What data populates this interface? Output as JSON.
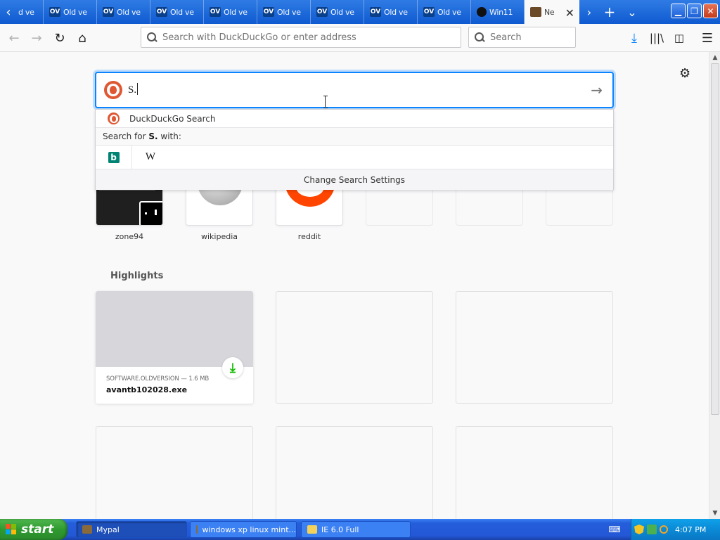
{
  "tabstrip": {
    "tabs": [
      {
        "icon": "OV",
        "title": "d ve",
        "state": "partial"
      },
      {
        "icon": "OV",
        "title": "Old ve"
      },
      {
        "icon": "OV",
        "title": "Old ve"
      },
      {
        "icon": "OV",
        "title": "Old ve"
      },
      {
        "icon": "OV",
        "title": "Old ve"
      },
      {
        "icon": "OV",
        "title": "Old ve"
      },
      {
        "icon": "OV",
        "title": "Old ve"
      },
      {
        "icon": "OV",
        "title": "Old ve"
      },
      {
        "icon": "OV",
        "title": "Old ve"
      },
      {
        "icon": "",
        "title": "Win11"
      },
      {
        "icon": "",
        "title": "Ne",
        "active": true
      }
    ],
    "new_tab_glyph": "+",
    "list_tabs_glyph": "⌄"
  },
  "navbar": {
    "address_placeholder": "Search with DuckDuckGo or enter address",
    "search_placeholder": "Search"
  },
  "search": {
    "query": "S.",
    "go_glyph": "→"
  },
  "dropdown": {
    "engine_name": "DuckDuckGo Search",
    "search_for_prefix": "Search for ",
    "search_for_term": "S.",
    "search_for_suffix": " with:",
    "engines": [
      {
        "name": "bing",
        "glyph": "b"
      },
      {
        "name": "wikipedia",
        "glyph": "W"
      }
    ],
    "settings_label": "Change Search Settings"
  },
  "top_sites": [
    {
      "label": "zone94"
    },
    {
      "label": "wikipedia"
    },
    {
      "label": "reddit"
    },
    {
      "label": ""
    },
    {
      "label": ""
    },
    {
      "label": ""
    }
  ],
  "highlights": {
    "title": "Highlights",
    "cards": [
      {
        "source": "SOFTWARE.OLDVERSION — 1.6 MB",
        "filename": "avantb102028.exe"
      }
    ]
  },
  "taskbar": {
    "start_label": "start",
    "tasks": [
      {
        "label": "Mypal",
        "active": true
      },
      {
        "label": "windows xp linux mint..."
      },
      {
        "label": "IE 6.0 Full"
      }
    ],
    "clock": "4:07 PM"
  },
  "colors": {
    "accent": "#0a84ff",
    "ddg": "#de5833",
    "reddit": "#ff4500",
    "download": "#12bc00",
    "xp_blue": "#245edb",
    "xp_green": "#2f9a30"
  }
}
